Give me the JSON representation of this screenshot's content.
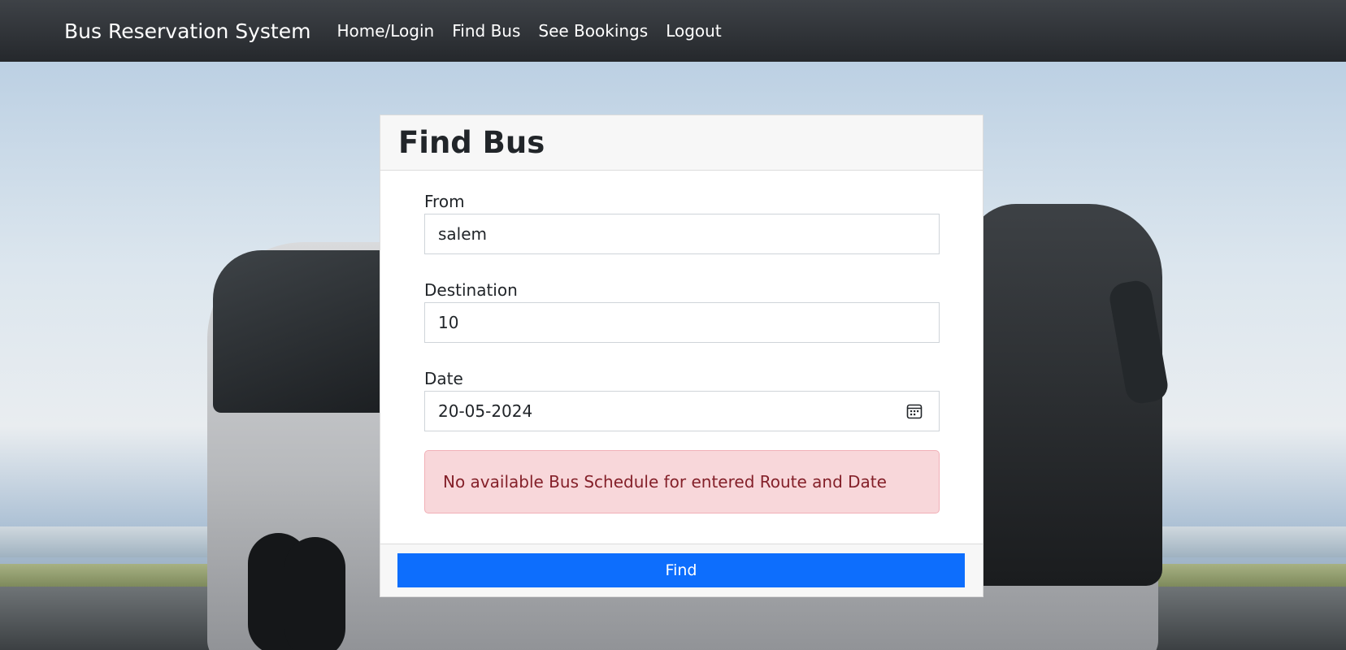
{
  "navbar": {
    "brand": "Bus Reservation System",
    "links": [
      "Home/Login",
      "Find Bus",
      "See Bookings",
      "Logout"
    ]
  },
  "form": {
    "title": "Find Bus",
    "from_label": "From",
    "from_value": "salem",
    "destination_label": "Destination",
    "destination_value": "10",
    "date_label": "Date",
    "date_value": "20-05-2024",
    "alert": "No available Bus Schedule for entered Route and Date",
    "submit_label": "Find"
  },
  "colors": {
    "navbar": "#343a40",
    "primary": "#0d6efd",
    "alert_bg": "#f8d7da",
    "alert_text": "#842029"
  }
}
